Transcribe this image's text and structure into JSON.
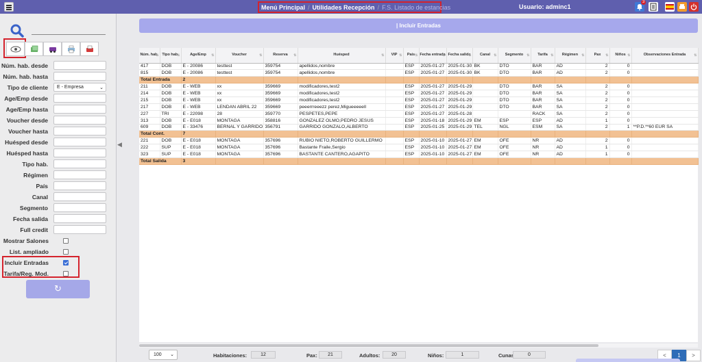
{
  "topbar": {
    "breadcrumb": [
      "Menú Principal",
      "Utilidades Recepción",
      "F.S. Listado de estancias"
    ],
    "user": "Usuario: adminc1",
    "notification_count": "3"
  },
  "sidebar": {
    "fields": [
      {
        "label": "Núm. hab. desde",
        "type": "text",
        "value": ""
      },
      {
        "label": "Núm. hab. hasta",
        "type": "text",
        "value": ""
      },
      {
        "label": "Tipo de cliente",
        "type": "select",
        "value": "E - Empresa"
      },
      {
        "label": "Age/Emp desde",
        "type": "text",
        "value": ""
      },
      {
        "label": "Age/Emp hasta",
        "type": "text",
        "value": ""
      },
      {
        "label": "Voucher desde",
        "type": "text",
        "value": ""
      },
      {
        "label": "Voucher hasta",
        "type": "text",
        "value": ""
      },
      {
        "label": "Huésped desde",
        "type": "text",
        "value": ""
      },
      {
        "label": "Huésped hasta",
        "type": "text",
        "value": ""
      },
      {
        "label": "Tipo hab.",
        "type": "text",
        "value": ""
      },
      {
        "label": "Régimen",
        "type": "text",
        "value": ""
      },
      {
        "label": "País",
        "type": "text",
        "value": ""
      },
      {
        "label": "Canal",
        "type": "text",
        "value": ""
      },
      {
        "label": "Segmento",
        "type": "text",
        "value": ""
      },
      {
        "label": "Fecha salida",
        "type": "text",
        "value": ""
      },
      {
        "label": "Full credit",
        "type": "text",
        "value": ""
      }
    ],
    "checkboxes": [
      {
        "label": "Mostrar Salones",
        "checked": false
      },
      {
        "label": "List. ampliado",
        "checked": false
      },
      {
        "label": "Incluir Entradas",
        "checked": true
      },
      {
        "label": "Tarifa/Reg. Mod.",
        "checked": false
      }
    ]
  },
  "main": {
    "header": "| Incluir Entradas",
    "columns": [
      "Núm. hab.",
      "Tipo hab.",
      "Age/Emp",
      "Voucher",
      "Reserva",
      "Huésped",
      "VIP",
      "País",
      "Fecha entrada",
      "Fecha salida",
      "Canal",
      "Segmento",
      "Tarifa",
      "Régimen",
      "Pax",
      "Niños",
      "Observaciones Entrada"
    ],
    "rows": [
      {
        "type": "data",
        "cells": [
          "417",
          "DOB",
          "E - 20086",
          "testtest",
          "359754",
          "apellidos,nombre",
          "",
          "ESP",
          "2025-01-27",
          "2025-01-30",
          "BK",
          "DTO",
          "BAR",
          "AD",
          "2",
          "0",
          ""
        ]
      },
      {
        "type": "data",
        "cells": [
          "815",
          "DOB",
          "E - 20086",
          "testtest",
          "359754",
          "apellidos,nombre",
          "",
          "ESP",
          "2025-01-27",
          "2025-01-30",
          "BK",
          "DTO",
          "BAR",
          "AD",
          "2",
          "0",
          ""
        ]
      },
      {
        "type": "total",
        "label": "Total Entrada",
        "value": "2"
      },
      {
        "type": "data",
        "cells": [
          "211",
          "DOB",
          "E - WEB",
          "xx",
          "359669",
          "modificadores,test2",
          "",
          "ESP",
          "2025-01-27",
          "2025-01-29",
          "",
          "DTO",
          "BAR",
          "SA",
          "2",
          "0",
          ""
        ]
      },
      {
        "type": "data",
        "cells": [
          "214",
          "DOB",
          "E - WEB",
          "xx",
          "359669",
          "modificadores,test2",
          "",
          "ESP",
          "2025-01-27",
          "2025-01-29",
          "",
          "DTO",
          "BAR",
          "SA",
          "2",
          "0",
          ""
        ]
      },
      {
        "type": "data",
        "cells": [
          "215",
          "DOB",
          "E - WEB",
          "xx",
          "359669",
          "modificadores,test2",
          "",
          "ESP",
          "2025-01-27",
          "2025-01-29",
          "",
          "DTO",
          "BAR",
          "SA",
          "2",
          "0",
          ""
        ]
      },
      {
        "type": "data",
        "cells": [
          "217",
          "DOB",
          "E - WEB",
          "LENDAN ABRIL 22",
          "359669",
          "peeerrreeezz perez,Migueeeeell",
          "",
          "ESP",
          "2025-01-27",
          "2025-01-29",
          "",
          "DTO",
          "BAR",
          "SA",
          "2",
          "0",
          ""
        ]
      },
      {
        "type": "data",
        "cells": [
          "227",
          "TRI",
          "E - 22098",
          "28",
          "359770",
          "PESPETES,PEPE",
          "",
          "ESP",
          "2025-01-27",
          "2025-01-28",
          "",
          "",
          "RACK",
          "SA",
          "2",
          "0",
          ""
        ]
      },
      {
        "type": "data",
        "cells": [
          "313",
          "DOB",
          "E - E018",
          "MONTAGA",
          "358816",
          "GONZALEZ OLMO,PEDRO JESUS",
          "",
          "ESP",
          "2025-01-18",
          "2025-01-29",
          "EM",
          "ESP",
          "ESP",
          "AD",
          "1",
          "0",
          ""
        ]
      },
      {
        "type": "data",
        "cells": [
          "609",
          "DOB",
          "E - 33476",
          "BERNAL Y GARRIDO",
          "356791",
          "GARRIDO GONZALO,ALBERTO",
          "",
          "ESP",
          "2025-01-25",
          "2025-01-29",
          "TEL",
          "NGL",
          "ESM",
          "SA",
          "2",
          "1",
          "**P.D.**60 EUR SA"
        ]
      },
      {
        "type": "total",
        "label": "Total Cont.",
        "value": "7"
      },
      {
        "type": "data",
        "cells": [
          "221",
          "DOB",
          "E - E018",
          "MONTAGA",
          "357696",
          "RUBIO NIETO,ROBERTO GUILLERMO",
          "",
          "ESP",
          "2025-01-10",
          "2025-01-27",
          "EM",
          "OFE",
          "NR",
          "AD",
          "2",
          "0",
          ""
        ]
      },
      {
        "type": "data",
        "cells": [
          "222",
          "SUP",
          "E - E018",
          "MONTAGA",
          "357696",
          "Bastante Fraile,Sergio",
          "",
          "ESP",
          "2025-01-10",
          "2025-01-27",
          "EM",
          "OFE",
          "NR",
          "AD",
          "1",
          "0",
          ""
        ]
      },
      {
        "type": "data",
        "cells": [
          "323",
          "SUP",
          "E - E018",
          "MONTAGA",
          "357696",
          "BASTANTE CANTERO,AGAPITO",
          "",
          "ESP",
          "2025-01-10",
          "2025-01-27",
          "EM",
          "OFE",
          "NR",
          "AD",
          "1",
          "0",
          ""
        ]
      },
      {
        "type": "total",
        "label": "Total Salida",
        "value": "3"
      }
    ]
  },
  "footer": {
    "page_size": "100",
    "habitaciones_label": "Habitaciones:",
    "habitaciones": "12",
    "pax_label": "Pax:",
    "pax": "21",
    "adultos_label": "Adultos:",
    "adultos": "20",
    "ninos_label": "Niños:",
    "ninos": "1",
    "cunas_label": "Cunas:",
    "cunas": "0",
    "pager": [
      "<",
      "1",
      ">"
    ]
  }
}
